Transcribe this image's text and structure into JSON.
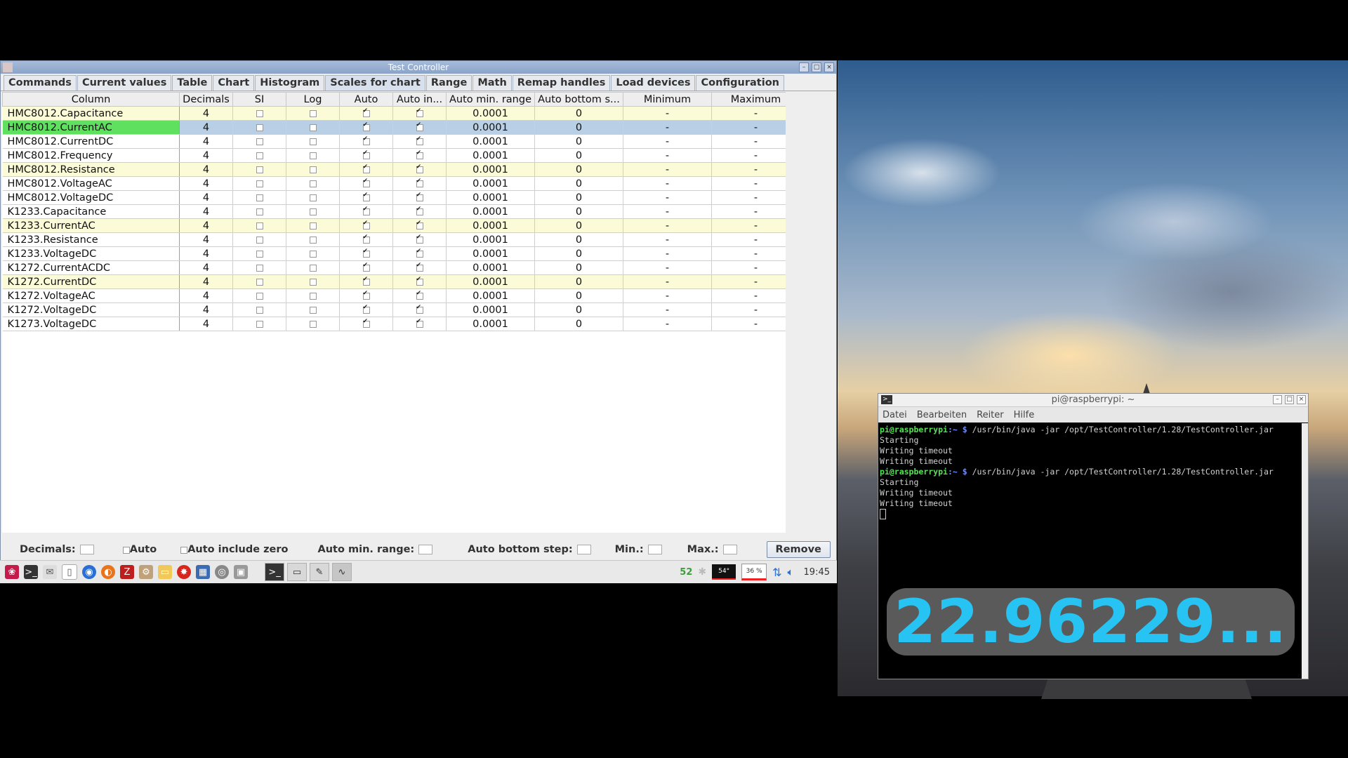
{
  "window": {
    "title": "Test Controller"
  },
  "tabs": [
    "Commands",
    "Current values",
    "Table",
    "Chart",
    "Histogram",
    "Scales for chart",
    "Range",
    "Math",
    "Remap handles",
    "Load devices",
    "Configuration"
  ],
  "active_tab": "Scales for chart",
  "table": {
    "headers": [
      "Column",
      "Decimals",
      "SI",
      "Log",
      "Auto",
      "Auto in...",
      "Auto min. range",
      "Auto bottom s...",
      "Minimum",
      "Maximum"
    ],
    "rows": [
      {
        "name": "HMC8012.Capacitance",
        "decimals": "4",
        "si": false,
        "log": false,
        "auto": true,
        "auto_include": true,
        "auto_min_range": "0.0001",
        "auto_bottom": "0",
        "minimum": "-",
        "maximum": "-",
        "highlight": true
      },
      {
        "name": "HMC8012.CurrentAC",
        "decimals": "4",
        "si": false,
        "log": false,
        "auto": true,
        "auto_include": true,
        "auto_min_range": "0.0001",
        "auto_bottom": "0",
        "minimum": "-",
        "maximum": "-",
        "selected": true
      },
      {
        "name": "HMC8012.CurrentDC",
        "decimals": "4",
        "si": false,
        "log": false,
        "auto": true,
        "auto_include": true,
        "auto_min_range": "0.0001",
        "auto_bottom": "0",
        "minimum": "-",
        "maximum": "-"
      },
      {
        "name": "HMC8012.Frequency",
        "decimals": "4",
        "si": false,
        "log": false,
        "auto": true,
        "auto_include": true,
        "auto_min_range": "0.0001",
        "auto_bottom": "0",
        "minimum": "-",
        "maximum": "-"
      },
      {
        "name": "HMC8012.Resistance",
        "decimals": "4",
        "si": false,
        "log": false,
        "auto": true,
        "auto_include": true,
        "auto_min_range": "0.0001",
        "auto_bottom": "0",
        "minimum": "-",
        "maximum": "-",
        "highlight": true
      },
      {
        "name": "HMC8012.VoltageAC",
        "decimals": "4",
        "si": false,
        "log": false,
        "auto": true,
        "auto_include": true,
        "auto_min_range": "0.0001",
        "auto_bottom": "0",
        "minimum": "-",
        "maximum": "-"
      },
      {
        "name": "HMC8012.VoltageDC",
        "decimals": "4",
        "si": false,
        "log": false,
        "auto": true,
        "auto_include": true,
        "auto_min_range": "0.0001",
        "auto_bottom": "0",
        "minimum": "-",
        "maximum": "-"
      },
      {
        "name": "K1233.Capacitance",
        "decimals": "4",
        "si": false,
        "log": false,
        "auto": true,
        "auto_include": true,
        "auto_min_range": "0.0001",
        "auto_bottom": "0",
        "minimum": "-",
        "maximum": "-"
      },
      {
        "name": "K1233.CurrentAC",
        "decimals": "4",
        "si": false,
        "log": false,
        "auto": true,
        "auto_include": true,
        "auto_min_range": "0.0001",
        "auto_bottom": "0",
        "minimum": "-",
        "maximum": "-",
        "highlight": true
      },
      {
        "name": "K1233.Resistance",
        "decimals": "4",
        "si": false,
        "log": false,
        "auto": true,
        "auto_include": true,
        "auto_min_range": "0.0001",
        "auto_bottom": "0",
        "minimum": "-",
        "maximum": "-"
      },
      {
        "name": "K1233.VoltageDC",
        "decimals": "4",
        "si": false,
        "log": false,
        "auto": true,
        "auto_include": true,
        "auto_min_range": "0.0001",
        "auto_bottom": "0",
        "minimum": "-",
        "maximum": "-"
      },
      {
        "name": "K1272.CurrentACDC",
        "decimals": "4",
        "si": false,
        "log": false,
        "auto": true,
        "auto_include": true,
        "auto_min_range": "0.0001",
        "auto_bottom": "0",
        "minimum": "-",
        "maximum": "-"
      },
      {
        "name": "K1272.CurrentDC",
        "decimals": "4",
        "si": false,
        "log": false,
        "auto": true,
        "auto_include": true,
        "auto_min_range": "0.0001",
        "auto_bottom": "0",
        "minimum": "-",
        "maximum": "-",
        "highlight": true
      },
      {
        "name": "K1272.VoltageAC",
        "decimals": "4",
        "si": false,
        "log": false,
        "auto": true,
        "auto_include": true,
        "auto_min_range": "0.0001",
        "auto_bottom": "0",
        "minimum": "-",
        "maximum": "-"
      },
      {
        "name": "K1272.VoltageDC",
        "decimals": "4",
        "si": false,
        "log": false,
        "auto": true,
        "auto_include": true,
        "auto_min_range": "0.0001",
        "auto_bottom": "0",
        "minimum": "-",
        "maximum": "-"
      },
      {
        "name": "K1273.VoltageDC",
        "decimals": "4",
        "si": false,
        "log": false,
        "auto": true,
        "auto_include": true,
        "auto_min_range": "0.0001",
        "auto_bottom": "0",
        "minimum": "-",
        "maximum": "-"
      }
    ]
  },
  "bottom": {
    "decimals_label": "Decimals:",
    "auto_label": "Auto",
    "auto_include_zero_label": "Auto include zero",
    "auto_min_range_label": "Auto min. range:",
    "auto_bottom_step_label": "Auto bottom step:",
    "min_label": "Min.:",
    "max_label": "Max.:",
    "remove_label": "Remove"
  },
  "taskbar": {
    "counter": "52",
    "cpu": "54°",
    "ram": "36 %",
    "clock": "19:45"
  },
  "terminal": {
    "title": "pi@raspberrypi: ~",
    "menu": [
      "Datei",
      "Bearbeiten",
      "Reiter",
      "Hilfe"
    ],
    "lines": [
      {
        "prompt_user": "pi@raspberrypi",
        "prompt_dir": ":~ $",
        "cmd": " /usr/bin/java -jar /opt/TestController/1.28/TestController.jar"
      },
      {
        "text": "Starting"
      },
      {
        "text": "Writing timeout"
      },
      {
        "text": "Writing timeout"
      },
      {
        "prompt_user": "pi@raspberrypi",
        "prompt_dir": ":~ $",
        "cmd": " /usr/bin/java -jar /opt/TestController/1.28/TestController.jar"
      },
      {
        "text": "Starting"
      },
      {
        "text": "Writing timeout"
      },
      {
        "text": "Writing timeout"
      }
    ]
  },
  "overlay_value": "22.96229..."
}
